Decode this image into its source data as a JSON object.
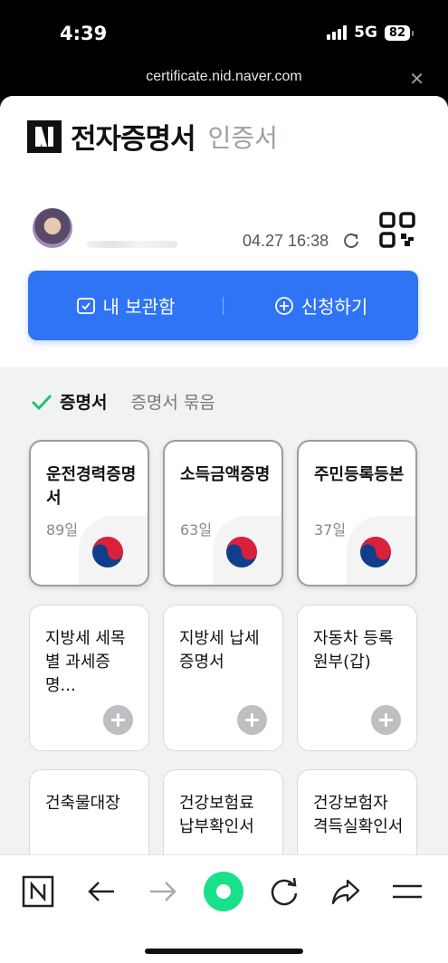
{
  "status_bar": {
    "time": "4:39",
    "network": "5G",
    "battery": "82"
  },
  "browser": {
    "url": "certificate.nid.naver.com",
    "close_icon": "close-icon"
  },
  "header": {
    "logo": "N",
    "title": "전자증명서",
    "subtitle": "인증서"
  },
  "profile": {
    "timestamp": "04.27 16:38"
  },
  "actions": {
    "storage_label": "내 보관함",
    "apply_label": "신청하기"
  },
  "tabs": {
    "active": "증명서",
    "other": "증명서 묶음"
  },
  "cards": [
    {
      "name": "운전경력증명서",
      "count": "89일",
      "owned": true
    },
    {
      "name": "소득금액증명",
      "count": "63일",
      "owned": true
    },
    {
      "name": "주민등록등본",
      "count": "37일",
      "owned": true
    },
    {
      "name": "지방세 세목별 과세증명...",
      "owned": false
    },
    {
      "name": "지방세 납세증명서",
      "owned": false
    },
    {
      "name": "자동차 등록원부(갑)",
      "owned": false
    },
    {
      "name": "건축물대장",
      "owned": false
    },
    {
      "name": "건강보험료 납부확인서",
      "owned": false
    },
    {
      "name": "건강보험자 격득실확인서",
      "owned": false
    }
  ],
  "colors": {
    "primary": "#2f74f5",
    "check": "#1fbf73",
    "nav_home": "#19e08a"
  }
}
